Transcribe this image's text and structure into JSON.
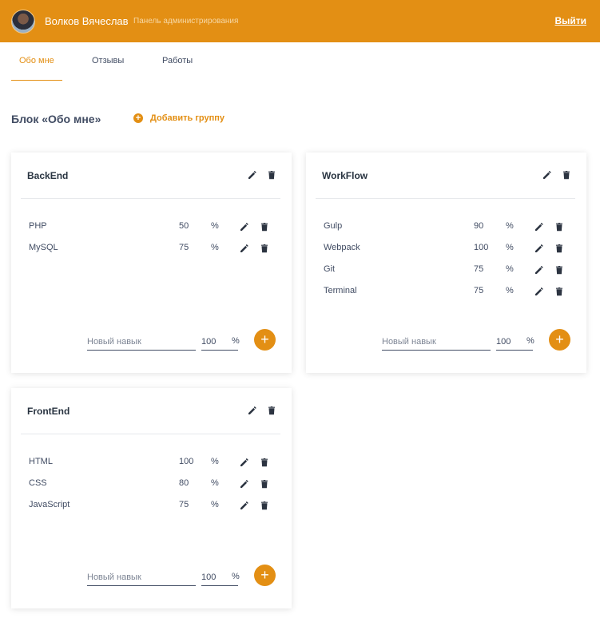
{
  "header": {
    "user_name": "Волков Вячеслав",
    "panel_title": "Панель администрирования",
    "logout_label": "Выйти",
    "brand_color": "#e38f14"
  },
  "tabs": [
    {
      "label": "Обо мне",
      "active": true
    },
    {
      "label": "Отзывы",
      "active": false
    },
    {
      "label": "Работы",
      "active": false
    }
  ],
  "section": {
    "title": "Блок «Обо мне»",
    "add_group_label": "Добавить группу"
  },
  "groups": [
    {
      "title": "BackEnd",
      "skills": [
        {
          "name": "PHP",
          "value": "50",
          "unit": "%"
        },
        {
          "name": "MySQL",
          "value": "75",
          "unit": "%"
        }
      ],
      "new_skill": {
        "placeholder": "Новый навык",
        "percent": "100",
        "unit": "%"
      }
    },
    {
      "title": "WorkFlow",
      "skills": [
        {
          "name": "Gulp",
          "value": "90",
          "unit": "%"
        },
        {
          "name": "Webpack",
          "value": "100",
          "unit": "%"
        },
        {
          "name": "Git",
          "value": "75",
          "unit": "%"
        },
        {
          "name": "Terminal",
          "value": "75",
          "unit": "%"
        }
      ],
      "new_skill": {
        "placeholder": "Новый навык",
        "percent": "100",
        "unit": "%"
      }
    },
    {
      "title": "FrontEnd",
      "skills": [
        {
          "name": "HTML",
          "value": "100",
          "unit": "%"
        },
        {
          "name": "CSS",
          "value": "80",
          "unit": "%"
        },
        {
          "name": "JavaScript",
          "value": "75",
          "unit": "%"
        }
      ],
      "new_skill": {
        "placeholder": "Новый навык",
        "percent": "100",
        "unit": "%"
      }
    }
  ],
  "icons": {
    "edit": "pencil-icon",
    "delete": "trash-icon",
    "add": "plus-icon"
  }
}
